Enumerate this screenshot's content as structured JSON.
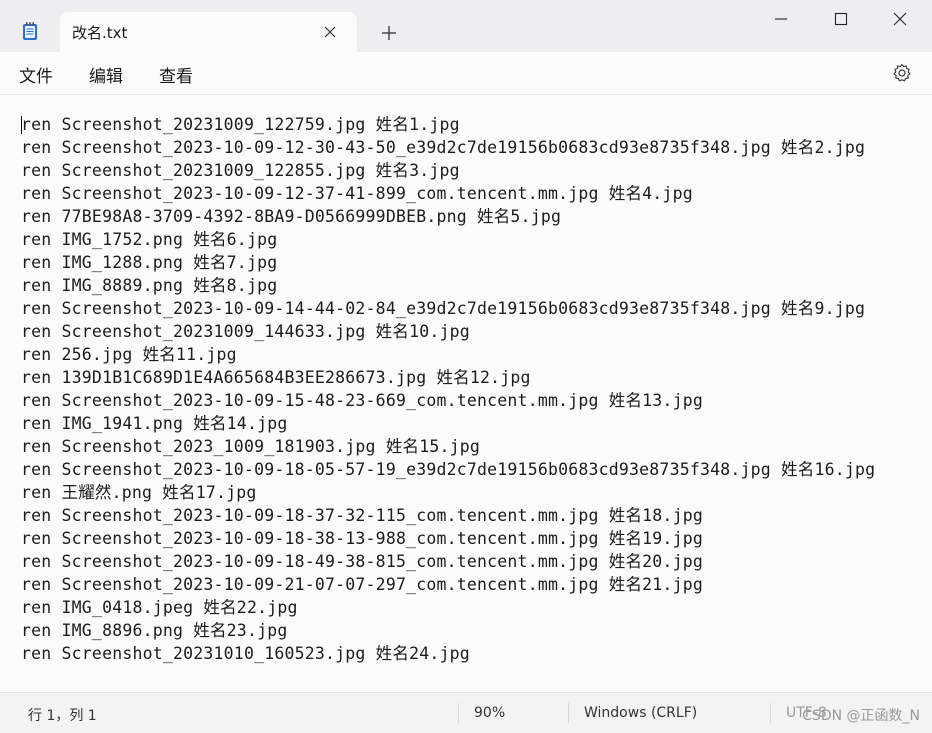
{
  "tab": {
    "title": "改名.txt"
  },
  "menu": {
    "file": "文件",
    "edit": "编辑",
    "view": "查看"
  },
  "lines": [
    "ren Screenshot_20231009_122759.jpg 姓名1.jpg",
    "ren Screenshot_2023-10-09-12-30-43-50_e39d2c7de19156b0683cd93e8735f348.jpg 姓名2.jpg",
    "ren Screenshot_20231009_122855.jpg 姓名3.jpg",
    "ren Screenshot_2023-10-09-12-37-41-899_com.tencent.mm.jpg 姓名4.jpg",
    "ren 77BE98A8-3709-4392-8BA9-D0566999DBEB.png 姓名5.jpg",
    "ren IMG_1752.png 姓名6.jpg",
    "ren IMG_1288.png 姓名7.jpg",
    "ren IMG_8889.png 姓名8.jpg",
    "ren Screenshot_2023-10-09-14-44-02-84_e39d2c7de19156b0683cd93e8735f348.jpg 姓名9.jpg",
    "ren Screenshot_20231009_144633.jpg 姓名10.jpg",
    "ren 256.jpg 姓名11.jpg",
    "ren 139D1B1C689D1E4A665684B3EE286673.jpg 姓名12.jpg",
    "ren Screenshot_2023-10-09-15-48-23-669_com.tencent.mm.jpg 姓名13.jpg",
    "ren IMG_1941.png 姓名14.jpg",
    "ren Screenshot_2023_1009_181903.jpg 姓名15.jpg",
    "ren Screenshot_2023-10-09-18-05-57-19_e39d2c7de19156b0683cd93e8735f348.jpg 姓名16.jpg",
    "ren 王耀然.png 姓名17.jpg",
    "ren Screenshot_2023-10-09-18-37-32-115_com.tencent.mm.jpg 姓名18.jpg",
    "ren Screenshot_2023-10-09-18-38-13-988_com.tencent.mm.jpg 姓名19.jpg",
    "ren Screenshot_2023-10-09-18-49-38-815_com.tencent.mm.jpg 姓名20.jpg",
    "ren Screenshot_2023-10-09-21-07-07-297_com.tencent.mm.jpg 姓名21.jpg",
    "ren IMG_0418.jpeg 姓名22.jpg",
    "ren IMG_8896.png 姓名23.jpg",
    "ren Screenshot_20231010_160523.jpg 姓名24.jpg"
  ],
  "status": {
    "position": "行 1，列 1",
    "zoom": "90%",
    "line_ending": "Windows (CRLF)",
    "encoding": "UTF-8",
    "watermark": "CSDN @正函数_N"
  },
  "icons": {
    "app": "notepad-icon",
    "close_tab": "close-icon",
    "new_tab": "plus-icon",
    "minimize": "minimize-icon",
    "maximize": "maximize-icon",
    "close_window": "close-icon",
    "settings": "gear-icon"
  },
  "colors": {
    "titlebar": "#eeeef1",
    "editor_bg": "#fbfbfb",
    "text": "#1c1c1c",
    "notepad_blue": "#2b6fd6"
  }
}
